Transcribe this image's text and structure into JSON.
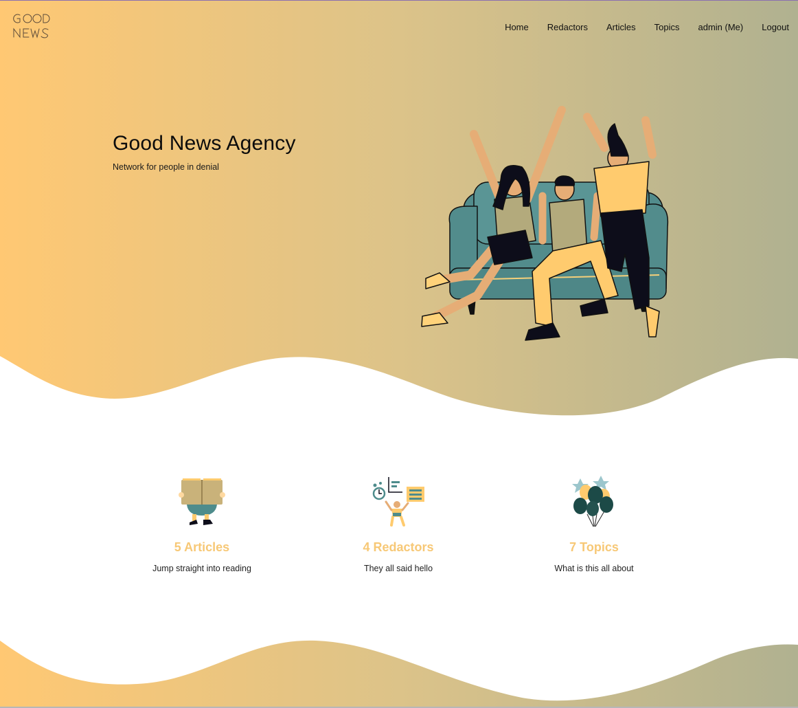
{
  "brand": {
    "logo_line1": "GOOD",
    "logo_line2": "NEWS"
  },
  "nav": {
    "items": [
      {
        "label": "Home"
      },
      {
        "label": "Redactors"
      },
      {
        "label": "Articles"
      },
      {
        "label": "Topics"
      },
      {
        "label": "admin (Me)"
      },
      {
        "label": "Logout"
      }
    ]
  },
  "hero": {
    "title": "Good News Agency",
    "subtitle": "Network for people in denial"
  },
  "features": [
    {
      "count_label": "5 Articles",
      "description": "Jump straight into reading",
      "icon": "reading-book-icon"
    },
    {
      "count_label": "4 Redactors",
      "description": "They all said hello",
      "icon": "team-tasks-icon"
    },
    {
      "count_label": "7 Topics",
      "description": "What is this all about",
      "icon": "balloons-icon"
    }
  ],
  "colors": {
    "gradient_start": "#ffc873",
    "gradient_end": "#b0b190",
    "accent": "#f7c876",
    "teal": "#4e8c8c",
    "dark": "#0d0d1a"
  }
}
